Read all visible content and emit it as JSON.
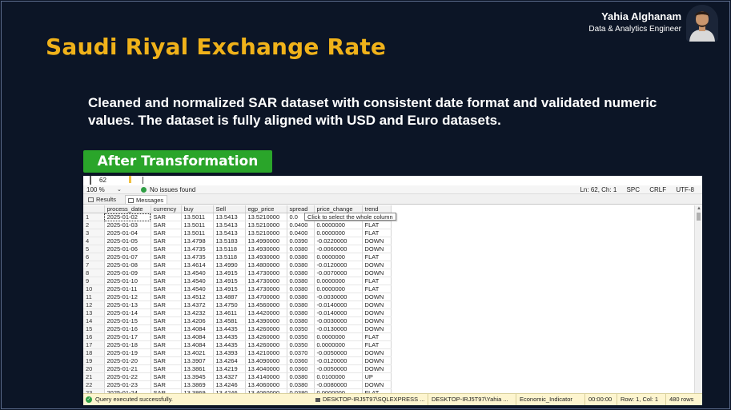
{
  "slide": {
    "title": "Saudi Riyal Exchange Rate",
    "description": "Cleaned and normalized SAR dataset with consistent date format and validated numeric values. The dataset is fully aligned with USD and Euro datasets.",
    "badge": "After Transformation"
  },
  "author": {
    "name": "Yahia Alghanam",
    "role": "Data & Analytics Engineer"
  },
  "ssms": {
    "editor_line": "62",
    "zoom": "100 %",
    "issues": "No issues found",
    "position": [
      "Ln: 62, Ch: 1",
      "SPC",
      "CRLF",
      "UTF-8"
    ],
    "tabs": [
      "Results",
      "Messages"
    ],
    "tooltip": "Click to select the whole column",
    "columns": [
      "process_date",
      "currency",
      "buy",
      "Sell",
      "egp_price",
      "spread",
      "price_change",
      "trend"
    ],
    "rows": [
      [
        "1",
        "2025-01-02",
        "SAR",
        "13.5011",
        "13.5413",
        "13.5210000",
        "0.0",
        "",
        ""
      ],
      [
        "2",
        "2025-01-03",
        "SAR",
        "13.5011",
        "13.5413",
        "13.5210000",
        "0.0400",
        "0.0000000",
        "FLAT"
      ],
      [
        "3",
        "2025-01-04",
        "SAR",
        "13.5011",
        "13.5413",
        "13.5210000",
        "0.0400",
        "0.0000000",
        "FLAT"
      ],
      [
        "4",
        "2025-01-05",
        "SAR",
        "13.4798",
        "13.5183",
        "13.4990000",
        "0.0390",
        "-0.0220000",
        "DOWN"
      ],
      [
        "5",
        "2025-01-06",
        "SAR",
        "13.4735",
        "13.5118",
        "13.4930000",
        "0.0380",
        "-0.0060000",
        "DOWN"
      ],
      [
        "6",
        "2025-01-07",
        "SAR",
        "13.4735",
        "13.5118",
        "13.4930000",
        "0.0380",
        "0.0000000",
        "FLAT"
      ],
      [
        "7",
        "2025-01-08",
        "SAR",
        "13.4614",
        "13.4990",
        "13.4800000",
        "0.0380",
        "-0.0120000",
        "DOWN"
      ],
      [
        "8",
        "2025-01-09",
        "SAR",
        "13.4540",
        "13.4915",
        "13.4730000",
        "0.0380",
        "-0.0070000",
        "DOWN"
      ],
      [
        "9",
        "2025-01-10",
        "SAR",
        "13.4540",
        "13.4915",
        "13.4730000",
        "0.0380",
        "0.0000000",
        "FLAT"
      ],
      [
        "10",
        "2025-01-11",
        "SAR",
        "13.4540",
        "13.4915",
        "13.4730000",
        "0.0380",
        "0.0000000",
        "FLAT"
      ],
      [
        "11",
        "2025-01-12",
        "SAR",
        "13.4512",
        "13.4887",
        "13.4700000",
        "0.0380",
        "-0.0030000",
        "DOWN"
      ],
      [
        "12",
        "2025-01-13",
        "SAR",
        "13.4372",
        "13.4750",
        "13.4560000",
        "0.0380",
        "-0.0140000",
        "DOWN"
      ],
      [
        "13",
        "2025-01-14",
        "SAR",
        "13.4232",
        "13.4611",
        "13.4420000",
        "0.0380",
        "-0.0140000",
        "DOWN"
      ],
      [
        "14",
        "2025-01-15",
        "SAR",
        "13.4206",
        "13.4581",
        "13.4390000",
        "0.0380",
        "-0.0030000",
        "DOWN"
      ],
      [
        "15",
        "2025-01-16",
        "SAR",
        "13.4084",
        "13.4435",
        "13.4260000",
        "0.0350",
        "-0.0130000",
        "DOWN"
      ],
      [
        "16",
        "2025-01-17",
        "SAR",
        "13.4084",
        "13.4435",
        "13.4260000",
        "0.0350",
        "0.0000000",
        "FLAT"
      ],
      [
        "17",
        "2025-01-18",
        "SAR",
        "13.4084",
        "13.4435",
        "13.4260000",
        "0.0350",
        "0.0000000",
        "FLAT"
      ],
      [
        "18",
        "2025-01-19",
        "SAR",
        "13.4021",
        "13.4393",
        "13.4210000",
        "0.0370",
        "-0.0050000",
        "DOWN"
      ],
      [
        "19",
        "2025-01-20",
        "SAR",
        "13.3907",
        "13.4264",
        "13.4090000",
        "0.0360",
        "-0.0120000",
        "DOWN"
      ],
      [
        "20",
        "2025-01-21",
        "SAR",
        "13.3861",
        "13.4219",
        "13.4040000",
        "0.0360",
        "-0.0050000",
        "DOWN"
      ],
      [
        "21",
        "2025-01-22",
        "SAR",
        "13.3945",
        "13.4327",
        "13.4140000",
        "0.0380",
        "0.0100000",
        "UP"
      ],
      [
        "22",
        "2025-01-23",
        "SAR",
        "13.3869",
        "13.4246",
        "13.4060000",
        "0.0380",
        "-0.0080000",
        "DOWN"
      ],
      [
        "23",
        "2025-01-24",
        "SAR",
        "13.3869",
        "13.4246",
        "13.4060000",
        "0.0380",
        "0.0000000",
        "FLAT"
      ]
    ],
    "status": {
      "message": "Query executed successfully.",
      "server": "DESKTOP-IRJ5T97\\SQLEXPRESS ...",
      "user": "DESKTOP-IRJ5T97\\Yahia ...",
      "database": "Economic_Indicator",
      "time": "00:00:00",
      "position": "Row: 1, Col: 1",
      "rows": "480 rows"
    }
  }
}
